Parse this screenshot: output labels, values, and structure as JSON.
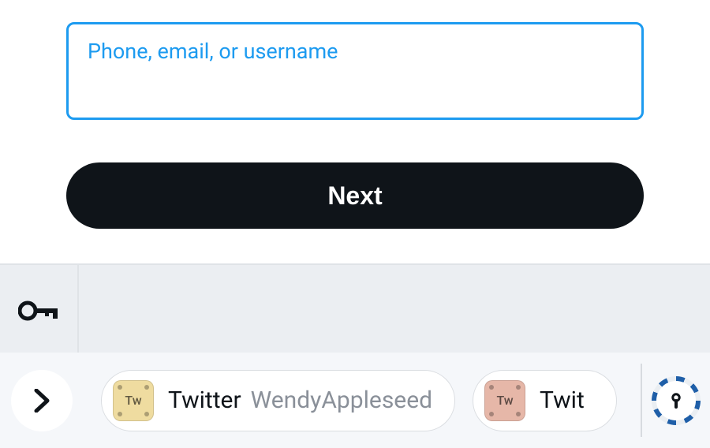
{
  "login": {
    "input_label": "Phone, email, or username",
    "input_value": "",
    "input_placeholder": "",
    "next_label": "Next"
  },
  "autofill_bar": {
    "suggestions": [
      {
        "service": "Twitter",
        "account": "WendyAppleseed",
        "icon_text": "Tw",
        "icon_bg": "#efdca0"
      },
      {
        "service": "Twit",
        "account": "",
        "icon_text": "Tw",
        "icon_bg": "#e6b7a8"
      }
    ]
  },
  "colors": {
    "accent": "#1d9bf0",
    "button_bg": "#0f1419"
  }
}
